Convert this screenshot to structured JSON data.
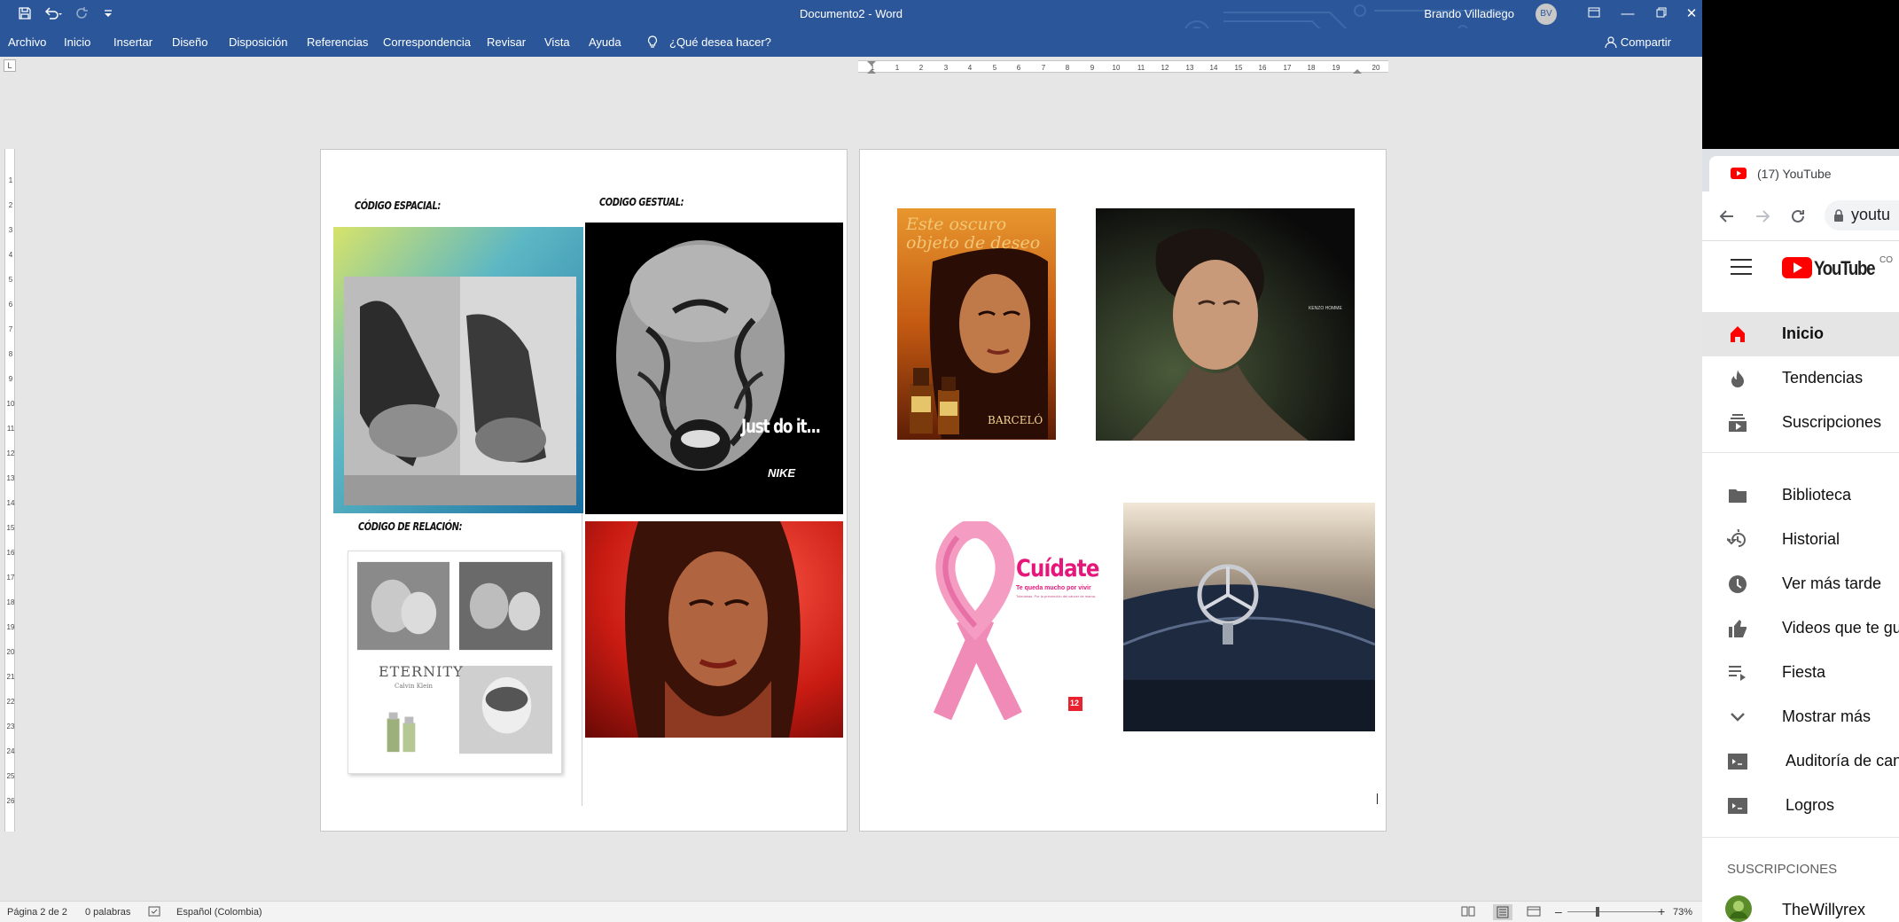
{
  "word": {
    "title": "Documento2  -  Word",
    "user_name": "Brando Villadiego",
    "user_initials": "BV",
    "ribbon_tabs": [
      "Archivo",
      "Inicio",
      "Insertar",
      "Diseño",
      "Disposición",
      "Referencias",
      "Correspondencia",
      "Revisar",
      "Vista",
      "Ayuda"
    ],
    "tell_me": "¿Qué desea hacer?",
    "share_label": "Compartir",
    "document": {
      "page1": {
        "heading_space": "CÓDIGO ESPACIAL:",
        "heading_gesture": "CODIGO GESTUAL:",
        "heading_relation": "CÓDIGO DE RELACIÓN:",
        "nike_slogan": "Just do it...",
        "nike_logo": "NIKE",
        "eternity_text": "ETERNITY",
        "eternity_brand": "Calvin Klein"
      },
      "page2": {
        "barcelo_tagline": "Este oscuro objeto de deseo",
        "barcelo_brand": "BARCELÓ",
        "kenzo_brand": "KENZO HOMME",
        "cuidate_title": "Cuídate",
        "cuidate_subtitle": "Te queda mucho por vivir",
        "cuidate_small": "Toledanas. Por la prevención del cáncer de mama.",
        "cuidate_badge": "12"
      }
    },
    "status": {
      "page": "Página 2 de 2",
      "words": "0 palabras",
      "language": "Español (Colombia)",
      "zoom": "73%"
    },
    "colors": {
      "accent": "#2b579a"
    }
  },
  "browser": {
    "tab_title": "(17) YouTube",
    "address": "youtu",
    "logo_text": "YouTube",
    "country": "CO",
    "nav": [
      {
        "label": "Inicio",
        "icon": "home-icon",
        "active": true
      },
      {
        "label": "Tendencias",
        "icon": "fire-icon"
      },
      {
        "label": "Suscripciones",
        "icon": "subscriptions-icon"
      },
      {
        "label": "Biblioteca",
        "icon": "library-icon"
      },
      {
        "label": "Historial",
        "icon": "history-icon"
      },
      {
        "label": "Ver más tarde",
        "icon": "clock-icon"
      },
      {
        "label": "Videos que te gu...",
        "icon": "thumbs-up-icon"
      },
      {
        "label": "Fiesta",
        "icon": "playlist-icon"
      },
      {
        "label": "Mostrar más",
        "icon": "chevron-down-icon"
      },
      {
        "label": "Auditoría de cana",
        "icon": "studio-icon"
      },
      {
        "label": "Logros",
        "icon": "studio-icon"
      }
    ],
    "subscriptions_header": "SUSCRIPCIONES",
    "subscriptions": [
      {
        "label": "TheWillyrex"
      }
    ],
    "colors": {
      "brand": "#ff0000"
    }
  }
}
